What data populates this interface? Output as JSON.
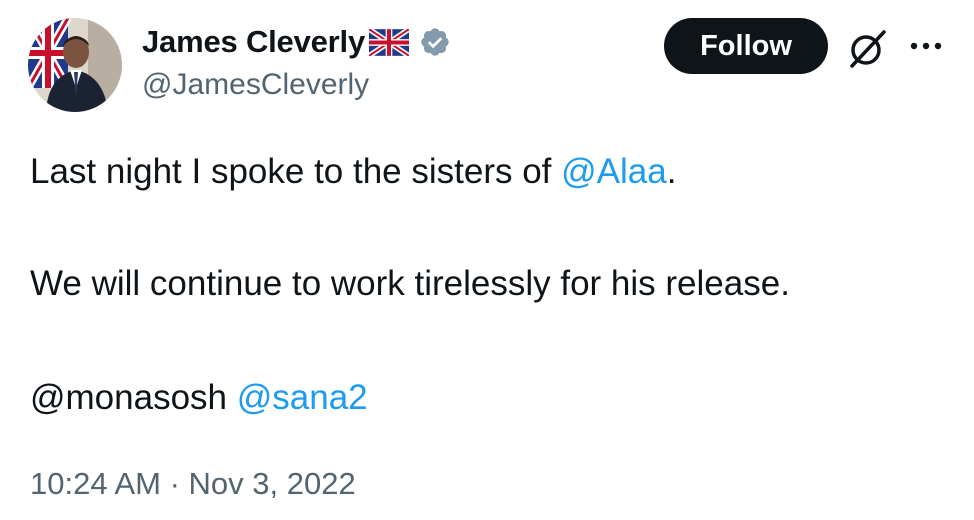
{
  "author": {
    "display_name": "James Cleverly",
    "handle": "@JamesCleverly",
    "flag_emoji": "gb-flag-icon",
    "verified": true
  },
  "actions": {
    "follow_label": "Follow",
    "grok_icon": "grok-icon",
    "more_icon": "more-icon"
  },
  "tweet": {
    "line1": {
      "text_before": "Last night I spoke to the sisters of ",
      "mention": "@Alaa",
      "text_after": "."
    },
    "line2": {
      "text": "We will continue to work tirelessly for his release."
    },
    "line3": {
      "mention_plain": "@monasosh",
      "separator": " ",
      "mention_link": "@sana2"
    }
  },
  "meta": {
    "timestamp": "10:24 AM · Nov 3, 2022"
  },
  "colors": {
    "text": "#0f1419",
    "secondary": "#536471",
    "link": "#1d9bf0",
    "verified_badge": "#829aab",
    "follow_bg": "#0f1419"
  }
}
